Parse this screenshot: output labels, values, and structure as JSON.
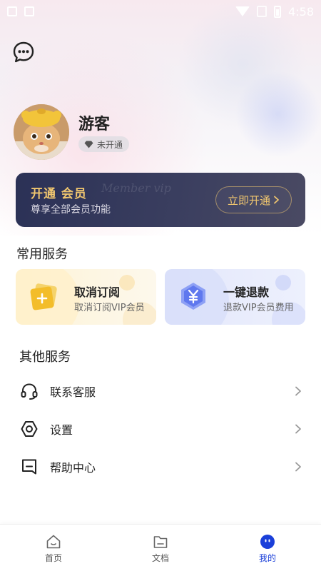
{
  "status_bar": {
    "time": "4:58"
  },
  "profile": {
    "name": "游客",
    "membership_status": "未开通"
  },
  "vip_card": {
    "title": "开通 会员",
    "subtitle": "尊享全部会员功能",
    "watermark": "Member vip",
    "button_label": "立即开通"
  },
  "common_services": {
    "title": "常用服务",
    "items": [
      {
        "label": "取消订阅",
        "desc": "取消订阅VIP会员",
        "icon": "plus-card-icon"
      },
      {
        "label": "一键退款",
        "desc": "退款VIP会员费用",
        "icon": "yen-hexagon-icon"
      }
    ]
  },
  "other_services": {
    "title": "其他服务",
    "items": [
      {
        "label": "联系客服",
        "icon": "headset-icon"
      },
      {
        "label": "设置",
        "icon": "hexagon-settings-icon"
      },
      {
        "label": "帮助中心",
        "icon": "help-message-icon"
      }
    ]
  },
  "tab_bar": {
    "tabs": [
      {
        "label": "首页",
        "icon": "home-icon",
        "active": false
      },
      {
        "label": "文档",
        "icon": "folder-icon",
        "active": false
      },
      {
        "label": "我的",
        "icon": "profile-face-icon",
        "active": true
      }
    ]
  },
  "colors": {
    "accent": "#1a3fd9",
    "gold": "#f0c66f",
    "vip_card": "#2b3156"
  }
}
